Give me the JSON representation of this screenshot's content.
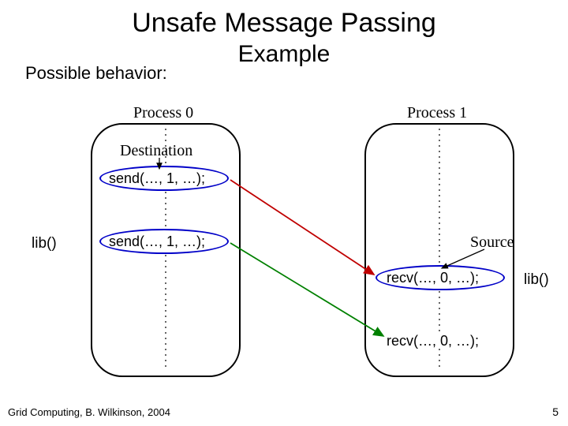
{
  "title": "Unsafe Message Passing",
  "subtitle": "Example",
  "behavior": "Possible behavior:",
  "process0": {
    "label": "Process 0",
    "dest_label": "Destination",
    "send1": "send(…, 1, …);",
    "send2": "send(…, 1, …);"
  },
  "process1": {
    "label": "Process 1",
    "src_label": "Source",
    "recv1": "recv(…, 0, …);",
    "recv2": "recv(…, 0, …);"
  },
  "lib_left": "lib()",
  "lib_right": "lib()",
  "footer": "Grid Computing, B. Wilkinson, 2004",
  "page": "5"
}
